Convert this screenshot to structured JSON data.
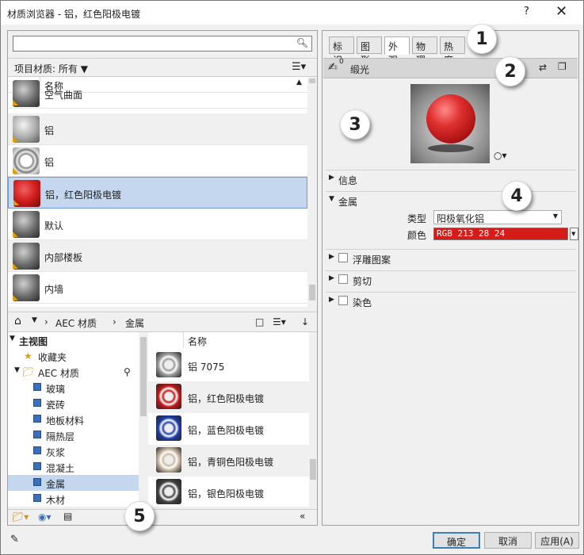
{
  "window": {
    "title": "材质浏览器 - 铝，红色阳极电镀",
    "help": "?",
    "close": "✕"
  },
  "left": {
    "search_placeholder": "",
    "project_label": "项目材质: 所有",
    "list_header": "名称",
    "materials": [
      {
        "name": "空气曲面",
        "thumb": "ball-gd"
      },
      {
        "name": "铝",
        "thumb": "ball-g"
      },
      {
        "name": "铝",
        "thumb": "ring"
      },
      {
        "name": "铝，红色阳极电镀",
        "thumb": "ball-r"
      },
      {
        "name": "默认",
        "thumb": "ball-gd"
      },
      {
        "name": "内部楼板",
        "thumb": "ball-gd"
      },
      {
        "name": "内墙",
        "thumb": "ball-gd"
      }
    ],
    "breadcrumb": [
      "AEC 材质",
      "金属"
    ],
    "tree": {
      "root": "主视图",
      "favorites": "收藏夹",
      "aec": "AEC 材质",
      "items": [
        "玻璃",
        "瓷砖",
        "地板材料",
        "隔热层",
        "灰浆",
        "混凝土",
        "金属",
        "木材"
      ]
    },
    "library_header": "名称",
    "library": [
      {
        "name": "铝 7075",
        "color": "#9a9a9a"
      },
      {
        "name": "铝，红色阳极电镀",
        "color": "#c01818"
      },
      {
        "name": "铝，蓝色阳极电镀",
        "color": "#1e3ca8"
      },
      {
        "name": "铝，青铜色阳极电镀",
        "color": "#c9b9a4"
      },
      {
        "name": "铝，银色阳极电镀",
        "color": "#404040"
      }
    ]
  },
  "right": {
    "tabs": [
      "标识",
      "图形",
      "外观",
      "物理",
      "热度"
    ],
    "active_tab": "外观",
    "asset_name": "缎光",
    "asset_count": "0",
    "sections": {
      "info": "信息",
      "metal": "金属",
      "relief": "浮雕图案",
      "cutout": "剪切",
      "tint": "染色"
    },
    "type_label": "类型",
    "type_value": "阳极氧化铝",
    "color_label": "颜色",
    "color_value": "RGB 213 28 24",
    "color_hex": "#d51c18"
  },
  "buttons": {
    "ok": "确定",
    "cancel": "取消",
    "apply": "应用(A)"
  },
  "callouts": [
    "1",
    "2",
    "3",
    "4",
    "5"
  ]
}
